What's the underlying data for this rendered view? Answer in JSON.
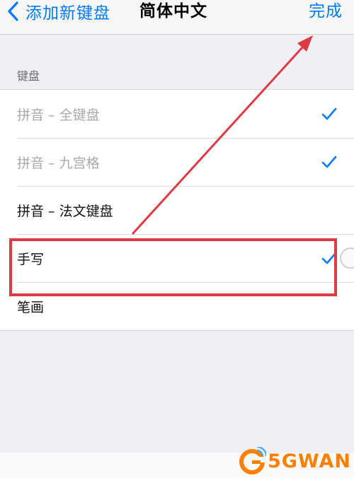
{
  "navbar": {
    "back_label": "添加新键盘",
    "title": "简体中文",
    "done_label": "完成"
  },
  "section": {
    "header": "键盘"
  },
  "keyboards": [
    {
      "label": "拼音 – 全键盘",
      "checked": true,
      "enabled": false
    },
    {
      "label": "拼音 – 九宫格",
      "checked": true,
      "enabled": false
    },
    {
      "label": "拼音 – 法文键盘",
      "checked": false,
      "enabled": true
    },
    {
      "label": "手写",
      "checked": true,
      "enabled": true
    },
    {
      "label": "笔画",
      "checked": false,
      "enabled": true
    }
  ],
  "watermark": {
    "text": "5GWAN"
  },
  "colors": {
    "accent": "#007aff",
    "annotation": "#de3a45",
    "brand": "#ff7f00"
  }
}
